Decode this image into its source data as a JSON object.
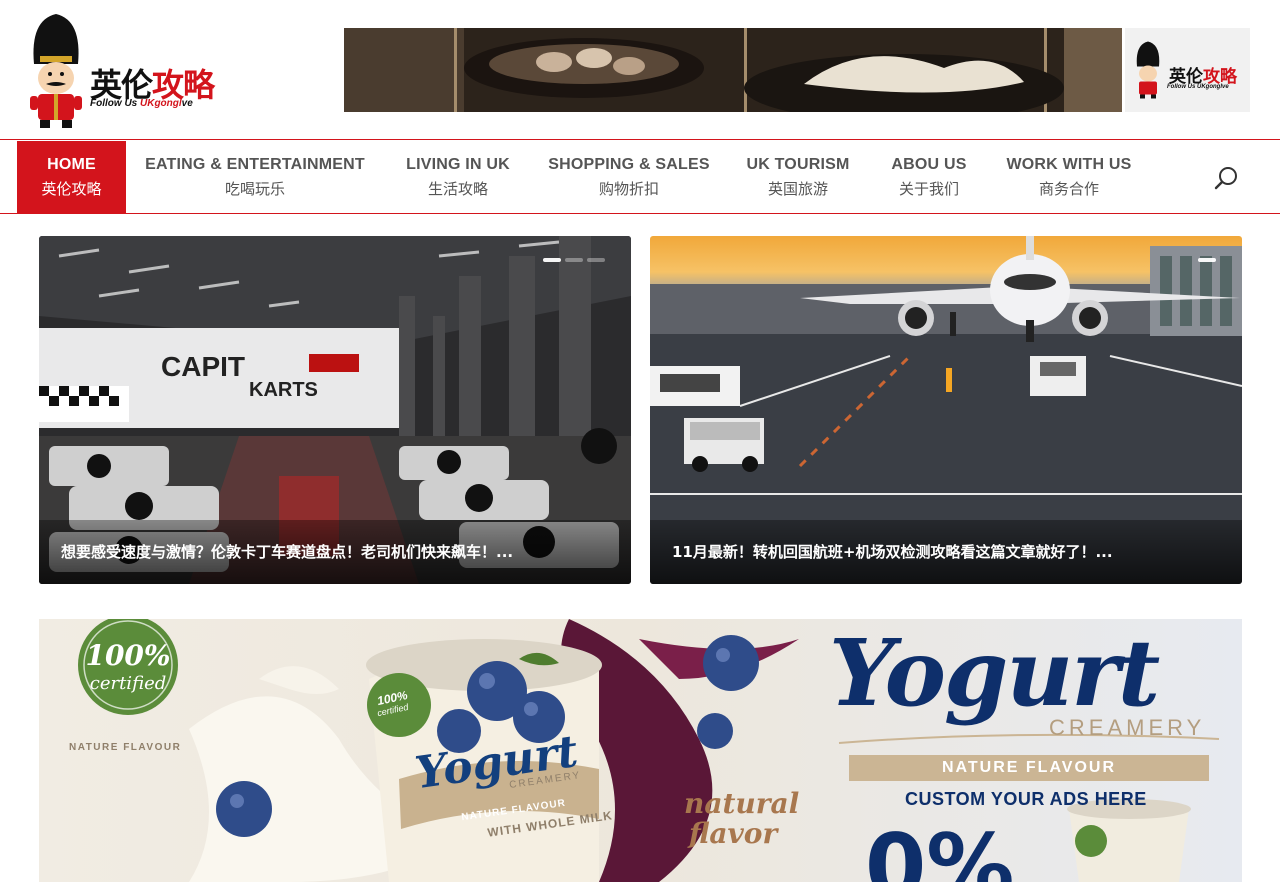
{
  "site": {
    "logo": {
      "brand_cn_a": "英伦",
      "brand_cn_b": "攻略",
      "brand_en_a": "Follow Us ",
      "brand_en_b": "UKgongl",
      "brand_en_c": "ve"
    },
    "banner_ad": {
      "mini_cn_a": "英伦",
      "mini_cn_b": "攻略",
      "mini_en": "Follow Us UKgonglve"
    }
  },
  "nav": {
    "items": [
      {
        "en": "HOME",
        "cn": "英伦攻略",
        "active": true
      },
      {
        "en": "EATING & ENTERTAINMENT",
        "cn": "吃喝玩乐",
        "active": false
      },
      {
        "en": "LIVING IN UK",
        "cn": "生活攻略",
        "active": false
      },
      {
        "en": "SHOPPING & SALES",
        "cn": "购物折扣",
        "active": false
      },
      {
        "en": "UK TOURISM",
        "cn": "英国旅游",
        "active": false
      },
      {
        "en": "ABOU US",
        "cn": "关于我们",
        "active": false
      },
      {
        "en": "WORK WITH US",
        "cn": "商务合作",
        "active": false
      }
    ],
    "search_icon": "search-icon"
  },
  "featured": [
    {
      "caption": "想要感受速度与激情？伦敦卡丁车赛道盘点！老司机们快来飙车！...",
      "image_text_a": "CAPIT",
      "image_text_b": "KARTS"
    },
    {
      "caption": "11月最新！转机回国航班+机场双检测攻略看这篇文章就好了！..."
    }
  ],
  "ad": {
    "badge_pct": "100%",
    "badge_word": "certified",
    "nature_left": "NATURE FLAVOUR",
    "brand_big": "Yogurt",
    "creamery": "CREAMERY",
    "ribbon": "NATURE FLAVOUR",
    "custom": "CUSTOM YOUR ADS HERE",
    "natural": "natural",
    "flavor": "flavor",
    "big_pct": "0%",
    "cup_brand": "Yogurt",
    "cup_creamery": "CREAMERY",
    "cup_band": "NATURE FLAVOUR",
    "cup_milk": "WITH WHOLE MILK",
    "cup_100": "100%",
    "cup_cert": "certified"
  },
  "colors": {
    "brand_red": "#d3141c",
    "nav_text": "#555555",
    "ad_navy": "#0e2f6b"
  }
}
